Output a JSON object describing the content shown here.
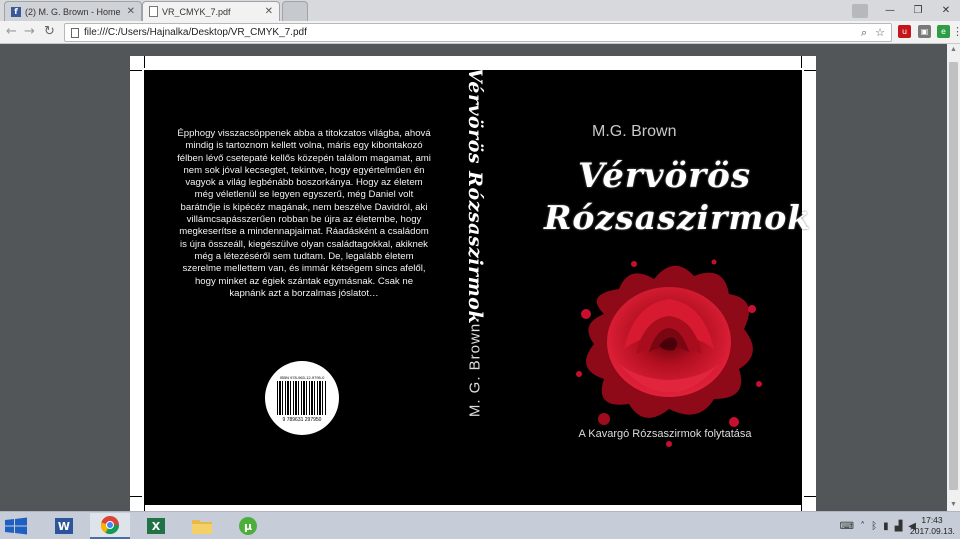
{
  "browser": {
    "tabs": [
      {
        "title": "(2) M. G. Brown - Home",
        "favicon": "facebook-icon"
      },
      {
        "title": "VR_CMYK_7.pdf",
        "favicon": "document-icon"
      }
    ],
    "address": "file:///C:/Users/Hajnalka/Desktop/VR_CMYK_7.pdf"
  },
  "cover": {
    "back_blurb": "Épphogy visszacsöppenek abba a titokzatos világba, ahová mindig is tartoznom kellett volna, máris egy kibontakozó félben lévő csetepaté kellős közepén találom magamat, ami nem sok jóval kecsegtet, tekintve, hogy egyértelműen én vagyok a világ legbénább boszorkánya. Hogy az életem még véletlenül se legyen egyszerű, még Daniel volt barátnője is kipécéz magának, nem beszélve Davidról, aki villámcsapásszerűen robban be újra az életembe, hogy megkeserítse a mindennapjaimat. Ráadásként a családom is újra összeáll, kiegészülve olyan családtagokkal, akiknek még a létezéséről sem tudtam. De, legalább életem szerelme mellettem van, és immár kétségem sincs afelől, hogy minket az égiek szántak egymásnak. Csak ne kapnánk azt a borzalmas jóslatot…",
    "isbn_top": "ISBN 978-963-12-9795-0",
    "isbn_bottom": "9 789631 297950",
    "spine_title": "Vérvörös Rózsaszirmok",
    "spine_author": "M. G. Brown",
    "author": "M.G. Brown",
    "title_line1": "Vérvörös",
    "title_line2": "Rózsaszirmok",
    "subtitle": "A Kavargó Rózsaszirmok folytatása"
  },
  "taskbar": {
    "time": "17:43",
    "date": "2017.09.13."
  },
  "colors": {
    "rose_red": "#c8102e",
    "cover_black": "#000000",
    "taskbar": "#c7cdd8"
  }
}
